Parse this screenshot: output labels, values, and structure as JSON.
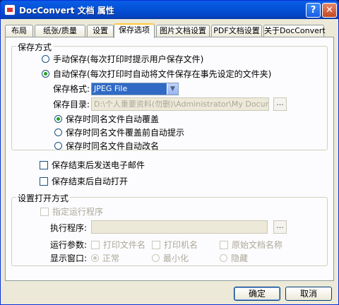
{
  "window": {
    "title": "DocConvert 文档 属性",
    "help_label": "?",
    "close_label": "✕"
  },
  "tabs": [
    {
      "label": "布局"
    },
    {
      "label": "纸张/质量"
    },
    {
      "label": "设置"
    },
    {
      "label": "保存选项"
    },
    {
      "label": "图片文档设置"
    },
    {
      "label": "PDF文档设置"
    },
    {
      "label": "关于DocConvert"
    }
  ],
  "save_mode": {
    "title": "保存方式",
    "manual": "手动保存(每次打印时提示用户保存文件)",
    "auto": "自动保存(每次打印时自动将文件保存在事先设定的文件夹)",
    "format_label": "保存格式:",
    "format_value": "JPEG File",
    "dir_label": "保存目录:",
    "dir_value": "D:\\个人重要资料(勿删)\\Administrator\\My Documents\\",
    "browse_label": "...",
    "overwrite": "保存时同名文件自动覆盖",
    "prompt": "保存时同名文件覆盖前自动提示",
    "rename": "保存时同名文件自动改名"
  },
  "options": {
    "send_email": "保存结束后发送电子邮件",
    "auto_open": "保存结束后自动打开"
  },
  "open_mode": {
    "title": "设置打开方式",
    "specify_program": "指定运行程序",
    "exec_label": "执行程序:",
    "exec_value": "",
    "browse_label": "...",
    "params_label": "运行参数:",
    "param_print_filename": "打印文件名",
    "param_print_machine": "打印机名",
    "param_original_name": "原始文档名称",
    "window_label": "显示窗口:",
    "win_normal": "正常",
    "win_minimize": "最小化",
    "win_hide": "隐藏"
  },
  "buttons": {
    "ok": "确定",
    "cancel": "取消"
  }
}
